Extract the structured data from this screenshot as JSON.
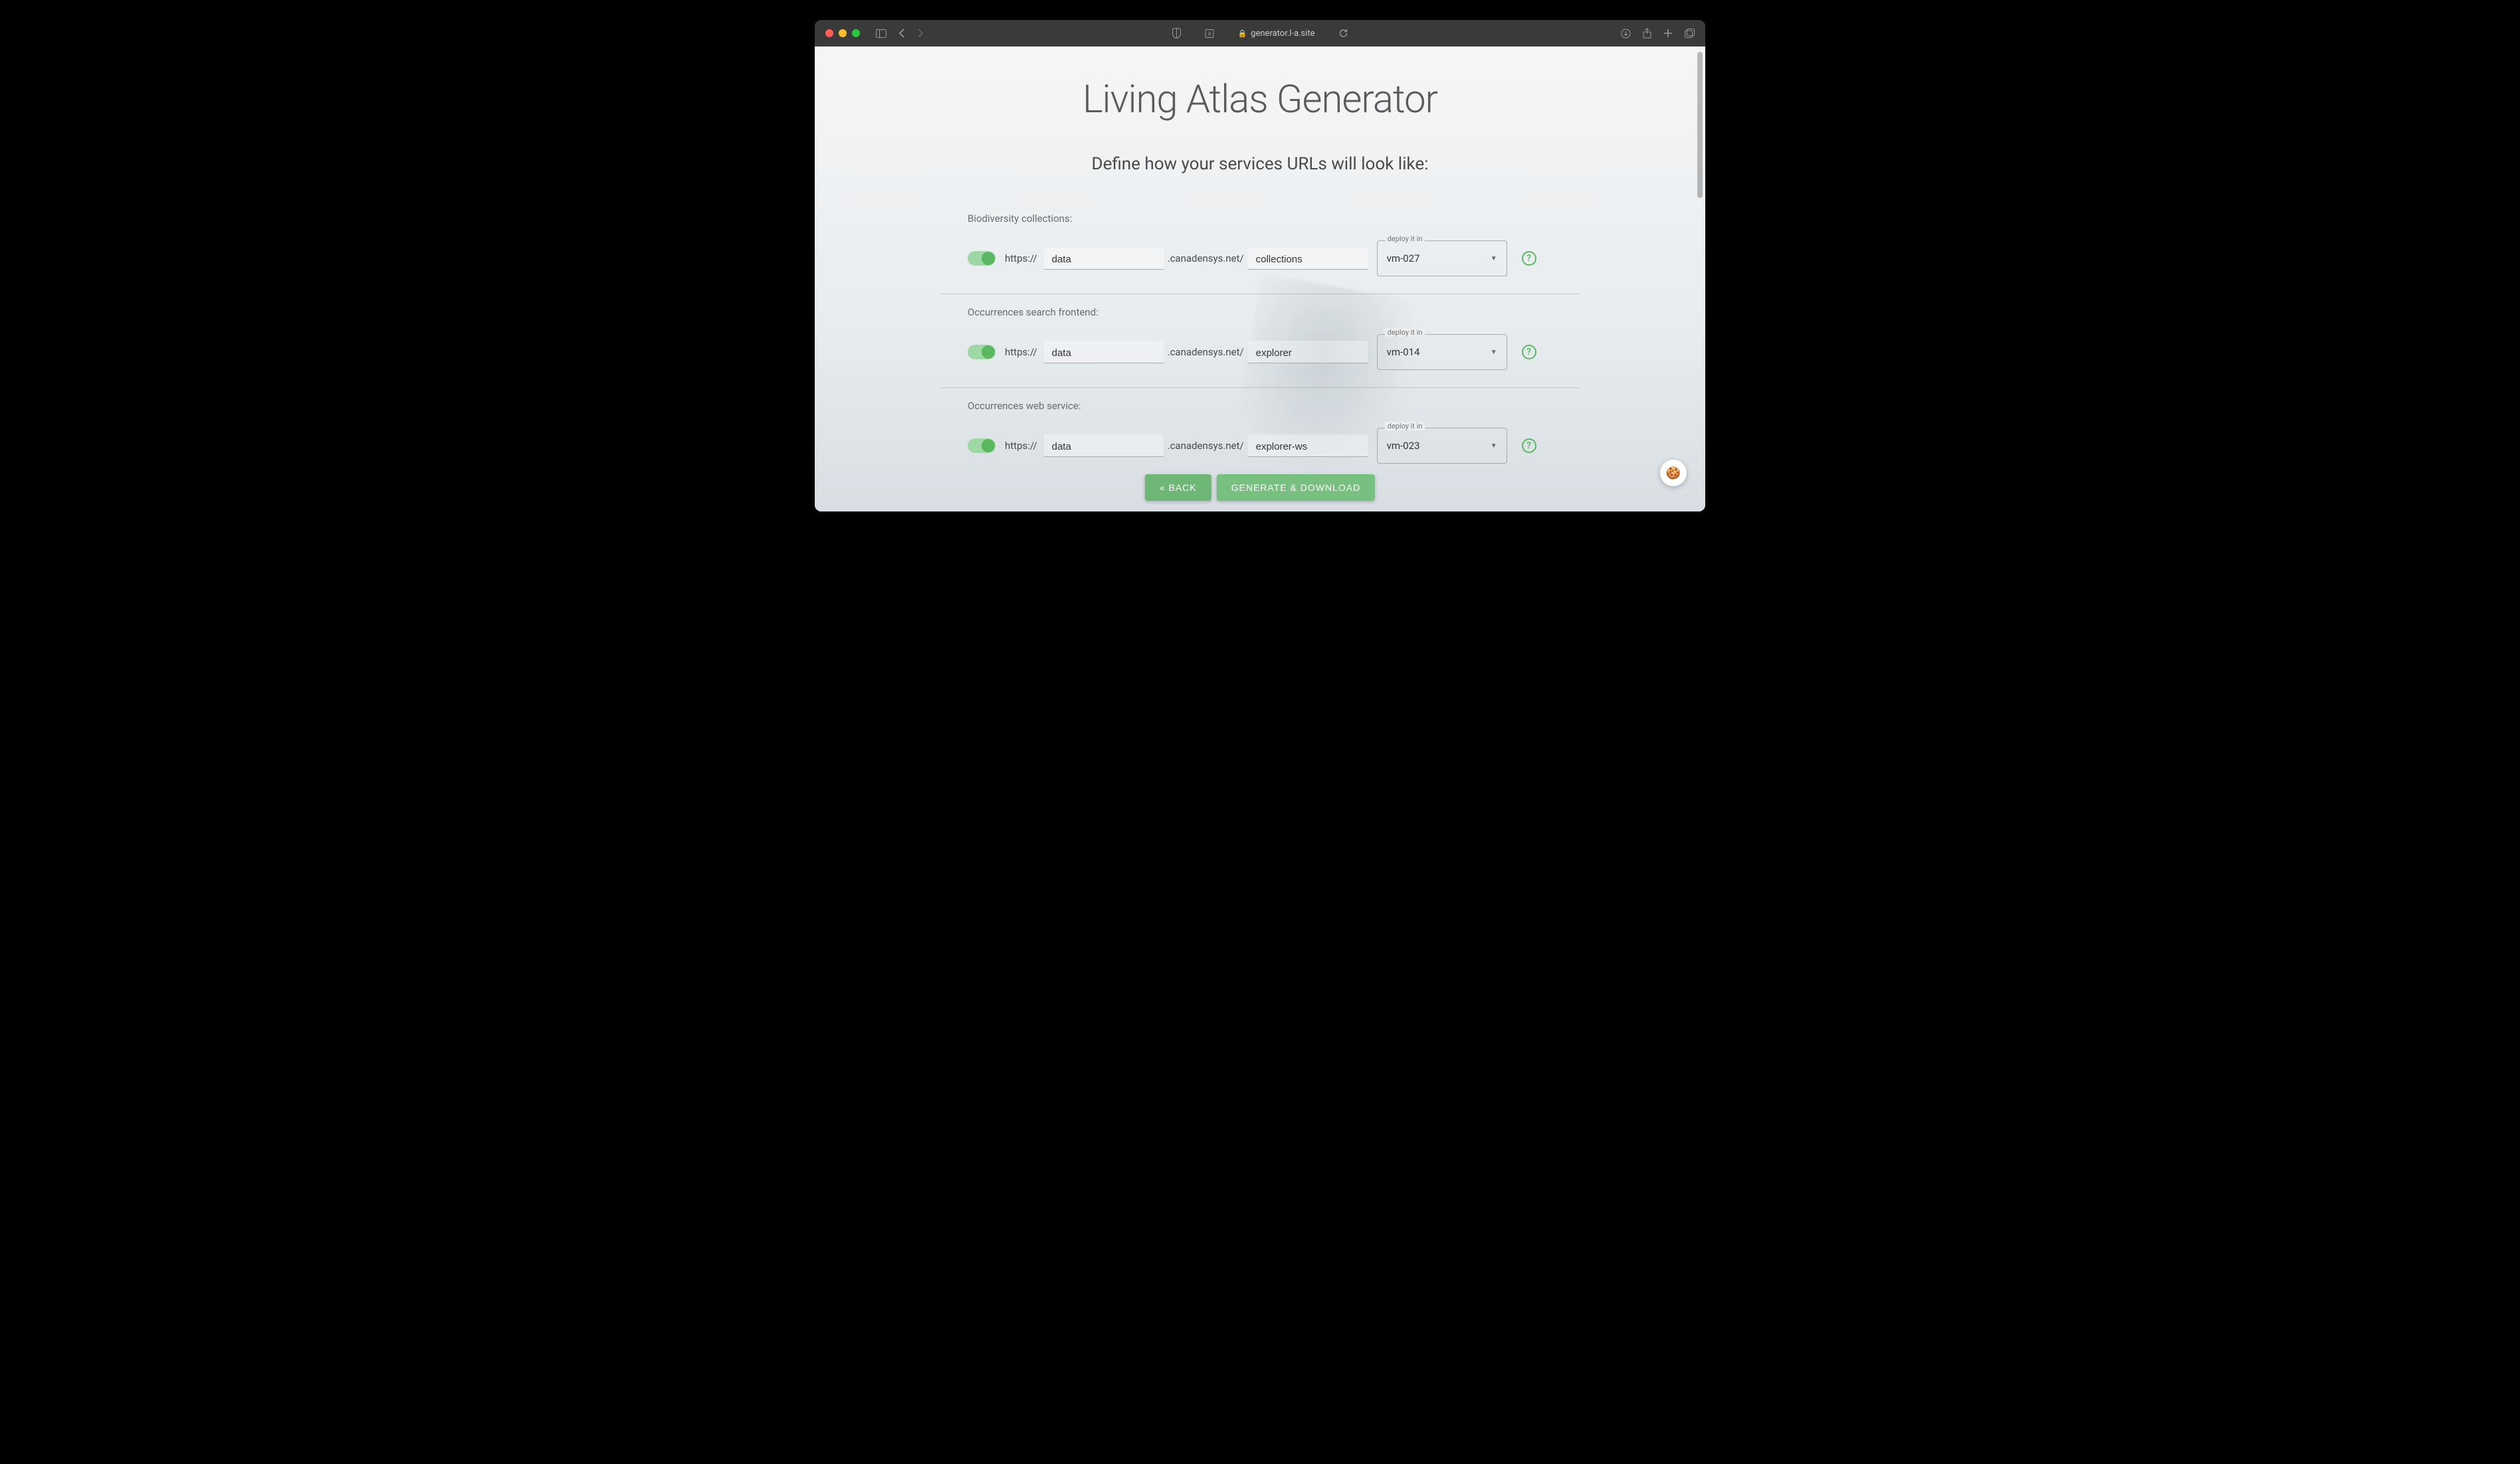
{
  "browser": {
    "url": "generator.l-a.site"
  },
  "page": {
    "title": "Living Atlas Generator",
    "subtitle": "Define how your services URLs will look like:"
  },
  "shared": {
    "protocol": "https://",
    "domain": ".canadensys.net/",
    "deploy_label": "deploy it in"
  },
  "services": [
    {
      "label": "Biodiversity collections:",
      "subdomain": "data",
      "path": "collections",
      "deploy": "vm-027"
    },
    {
      "label": "Occurrences search frontend:",
      "subdomain": "data",
      "path": "explorer",
      "deploy": "vm-014"
    },
    {
      "label": "Occurrences web service:",
      "subdomain": "data",
      "path": "explorer-ws",
      "deploy": "vm-023"
    }
  ],
  "buttons": {
    "back": "« BACK",
    "generate": "GENERATE & DOWNLOAD"
  }
}
